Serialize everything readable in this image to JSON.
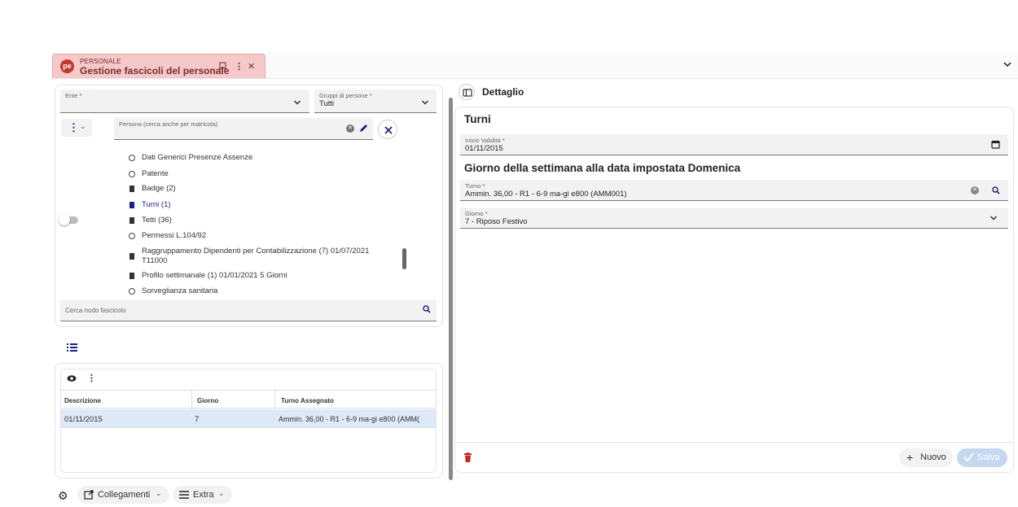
{
  "tab": {
    "module": "PERSONALE",
    "title": "Gestione fascicoli del personale",
    "logo": "pe"
  },
  "left": {
    "ente_label": "Ente",
    "ente_value": "",
    "gruppi_label": "Gruppi di persone",
    "gruppi_value": "Tutti",
    "persona_label": "Persona (cerca anche per matricola)",
    "tree_items": [
      {
        "label": "Dati Generici Presenze Assenze",
        "icon": "circle"
      },
      {
        "label": "Patente",
        "icon": "circle"
      },
      {
        "label": "Badge (2)",
        "icon": "document"
      },
      {
        "label": "Turni (1)",
        "icon": "document"
      },
      {
        "label": "Tetti (36)",
        "icon": "document"
      },
      {
        "label": "Permessi L.104/92",
        "icon": "circle"
      },
      {
        "label": "Raggruppamento Dipendenti per Contabilizzazione (7) 01/07/2021",
        "label2": "T11000",
        "icon": "document"
      },
      {
        "label": "Profilo settimanale (1) 01/01/2021  5 Giorni",
        "icon": "document"
      },
      {
        "label": "Sorveglianza sanitaria",
        "icon": "circle"
      }
    ],
    "search_placeholder": "Cerca nodo fascicolo",
    "table": {
      "headers": [
        "Descrizione",
        "Giorno",
        "Turno Assegnato"
      ],
      "rows": [
        [
          "01/11/2015",
          "7",
          "Ammin. 36,00 - R1 - 6-9 ma-gi e800 (AMM("
        ]
      ]
    }
  },
  "right": {
    "header": "Dettaglio",
    "section_title": "Turni",
    "inizio_label": "Inizio Validità",
    "inizio_value": "01/11/2015",
    "subtitle": "Giorno della settimana alla data impostata Domenica",
    "turno_label": "Turno",
    "turno_value": "Ammin. 36,00 - R1 - 6-9 ma-gi e800 (AMM001)",
    "giorno_label": "Giorno",
    "giorno_value": "7 - Riposo Festivo",
    "nuovo_label": "Nuovo",
    "salva_label": "Salva"
  },
  "bottom": {
    "collegamenti_label": "Collegamenti",
    "extra_label": "Extra"
  },
  "colors": {
    "accent": "#c0392b",
    "tab_bg": "#f5c9c9",
    "selected_row": "#dde9f7",
    "tree_selected": "#1a237e"
  }
}
